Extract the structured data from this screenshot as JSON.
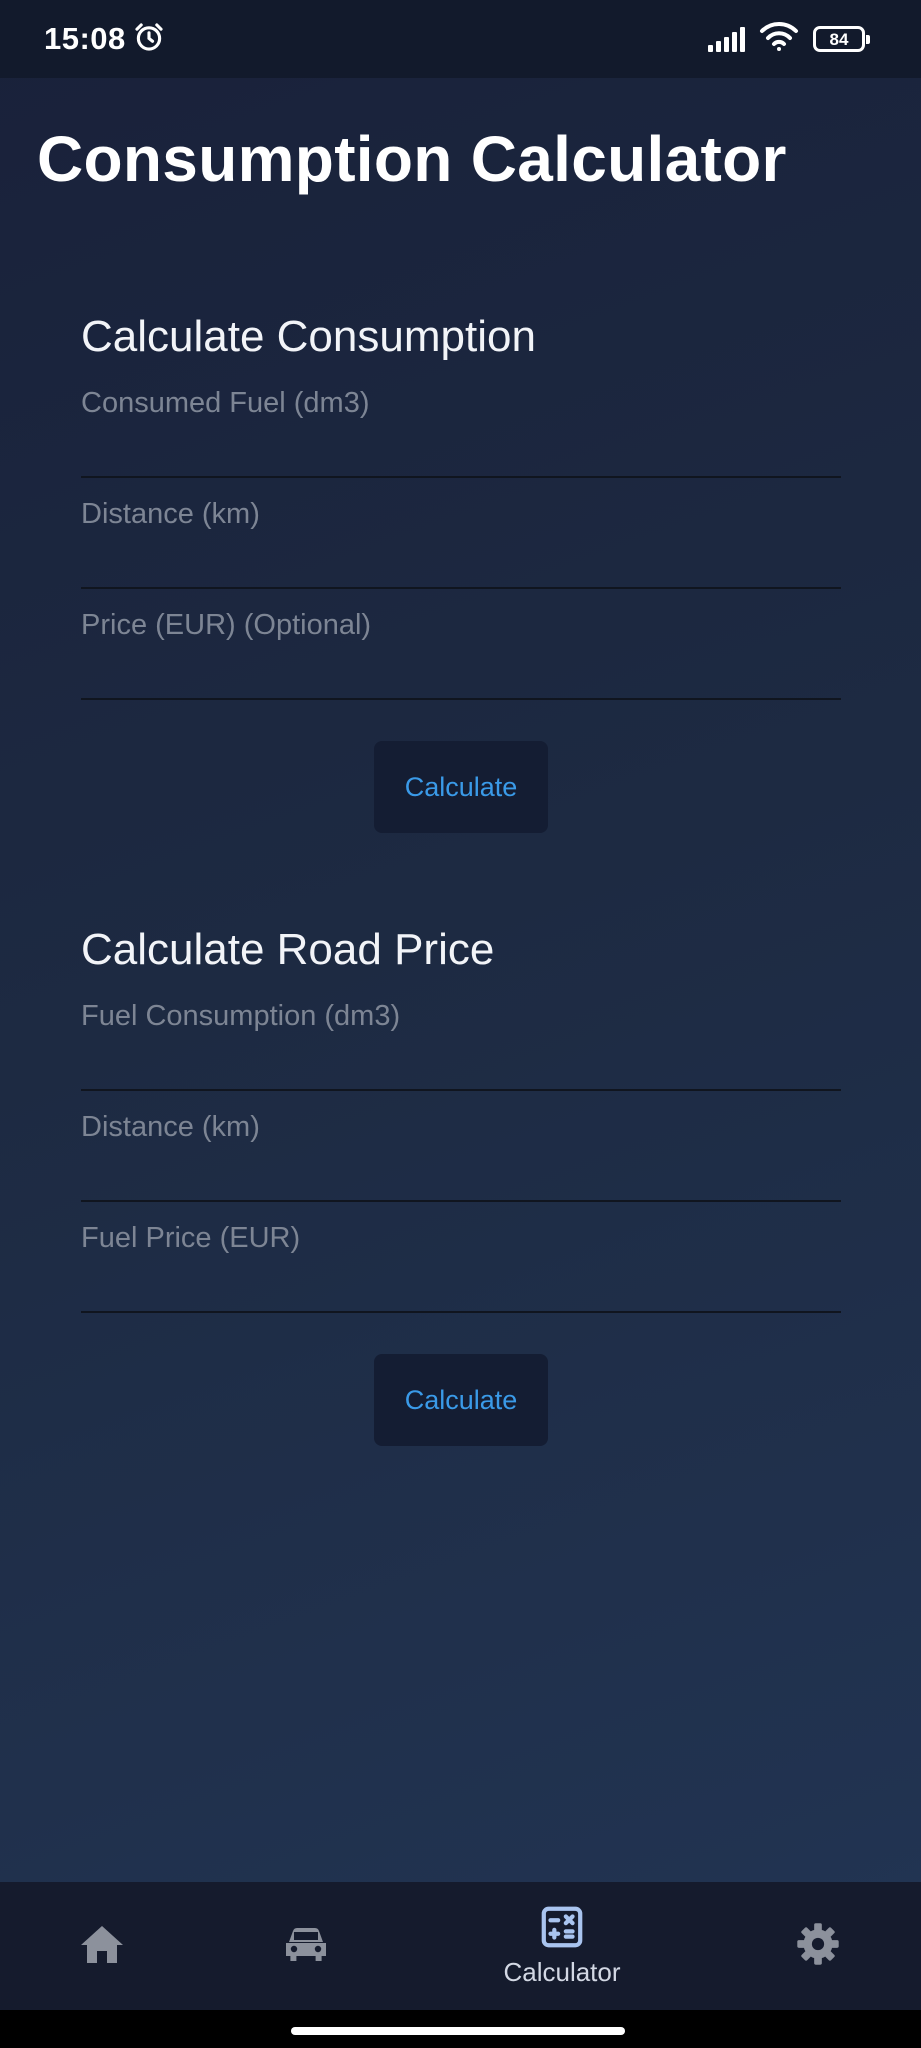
{
  "status_bar": {
    "time": "15:08",
    "battery": "84",
    "icons": [
      "alarm-icon",
      "signal-icon",
      "wifi-icon",
      "battery-icon"
    ]
  },
  "page": {
    "title": "Consumption Calculator"
  },
  "consumption": {
    "title": "Calculate Consumption",
    "fields": [
      {
        "label": "Consumed Fuel (dm3)",
        "value": ""
      },
      {
        "label": "Distance (km)",
        "value": ""
      },
      {
        "label": "Price (EUR) (Optional)",
        "value": ""
      }
    ],
    "button": "Calculate"
  },
  "road_price": {
    "title": "Calculate Road Price",
    "fields": [
      {
        "label": "Fuel Consumption (dm3)",
        "value": ""
      },
      {
        "label": "Distance (km)",
        "value": ""
      },
      {
        "label": "Fuel Price (EUR)",
        "value": ""
      }
    ],
    "button": "Calculate"
  },
  "nav": {
    "items": [
      {
        "icon": "home-icon",
        "label": ""
      },
      {
        "icon": "car-icon",
        "label": ""
      },
      {
        "icon": "calculator-icon",
        "label": "Calculator",
        "active": true
      },
      {
        "icon": "gear-icon",
        "label": ""
      }
    ]
  },
  "colors": {
    "accent": "#3a9ae8",
    "background_top": "#19213a",
    "background_bottom": "#223554",
    "nav_background": "#151b2d",
    "button_background": "#141d33",
    "label_text": "#7d8594",
    "active_icon": "#a9c4ef",
    "inactive_icon": "#8c919c"
  }
}
